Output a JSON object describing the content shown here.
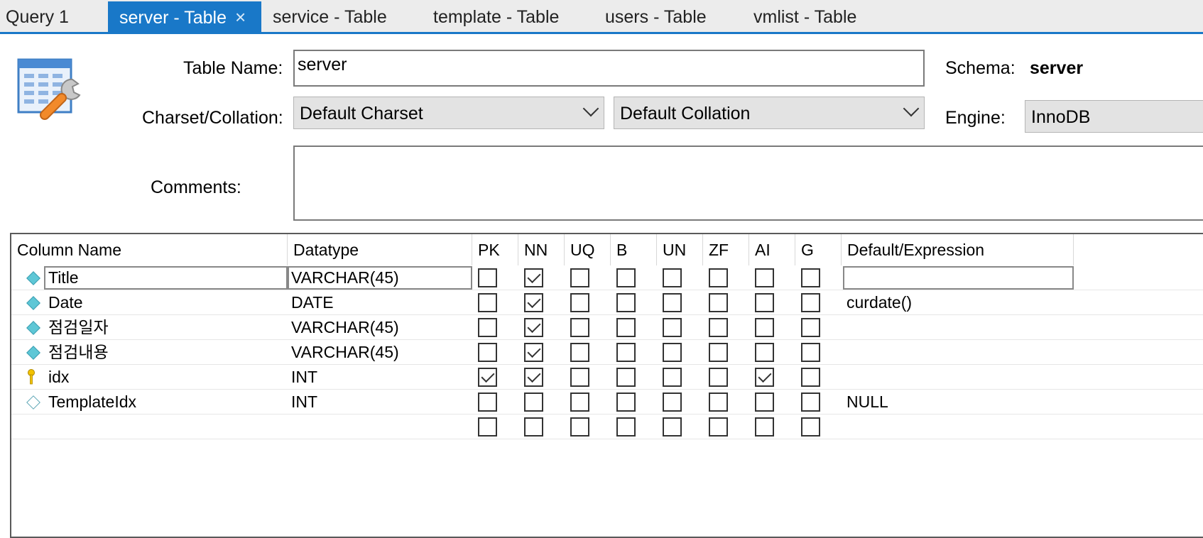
{
  "tabs": [
    {
      "label": "Query 1",
      "active": false
    },
    {
      "label": "server - Table",
      "active": true,
      "close": "×"
    },
    {
      "label": "service - Table",
      "active": false
    },
    {
      "label": "template - Table",
      "active": false
    },
    {
      "label": "users - Table",
      "active": false
    },
    {
      "label": "vmlist - Table",
      "active": false
    }
  ],
  "form": {
    "table_name_label": "Table Name:",
    "table_name_value": "server",
    "schema_label": "Schema:",
    "schema_value": "server",
    "charset_label": "Charset/Collation:",
    "charset_value": "Default Charset",
    "collation_value": "Default Collation",
    "engine_label": "Engine:",
    "engine_value": "InnoDB",
    "comments_label": "Comments:",
    "comments_value": ""
  },
  "grid": {
    "headers": [
      "Column Name",
      "Datatype",
      "PK",
      "NN",
      "UQ",
      "B",
      "UN",
      "ZF",
      "AI",
      "G",
      "Default/Expression"
    ],
    "rows": [
      {
        "name": "Title",
        "type": "VARCHAR(45)",
        "flags": [
          false,
          true,
          false,
          false,
          false,
          false,
          false,
          false
        ],
        "default": "",
        "icon": "column-icon"
      },
      {
        "name": "Date",
        "type": "DATE",
        "flags": [
          false,
          true,
          false,
          false,
          false,
          false,
          false,
          false
        ],
        "default": "curdate()",
        "icon": "column-icon"
      },
      {
        "name": "점검일자",
        "type": "VARCHAR(45)",
        "flags": [
          false,
          true,
          false,
          false,
          false,
          false,
          false,
          false
        ],
        "default": "",
        "icon": "column-icon"
      },
      {
        "name": "점검내용",
        "type": "VARCHAR(45)",
        "flags": [
          false,
          true,
          false,
          false,
          false,
          false,
          false,
          false
        ],
        "default": "",
        "icon": "column-icon"
      },
      {
        "name": "idx",
        "type": "INT",
        "flags": [
          true,
          true,
          false,
          false,
          false,
          false,
          true,
          false
        ],
        "default": "",
        "icon": "primary-key-icon"
      },
      {
        "name": "TemplateIdx",
        "type": "INT",
        "flags": [
          false,
          false,
          false,
          false,
          false,
          false,
          false,
          false
        ],
        "default": "NULL",
        "icon": "nullable-column-icon"
      },
      {
        "name": "",
        "type": "",
        "flags": [
          false,
          false,
          false,
          false,
          false,
          false,
          false,
          false
        ],
        "default": "",
        "icon": ""
      }
    ]
  },
  "colors": {
    "accent": "#1978c8",
    "key": "#f2c200",
    "column_diamond": "#5ec7d6"
  }
}
